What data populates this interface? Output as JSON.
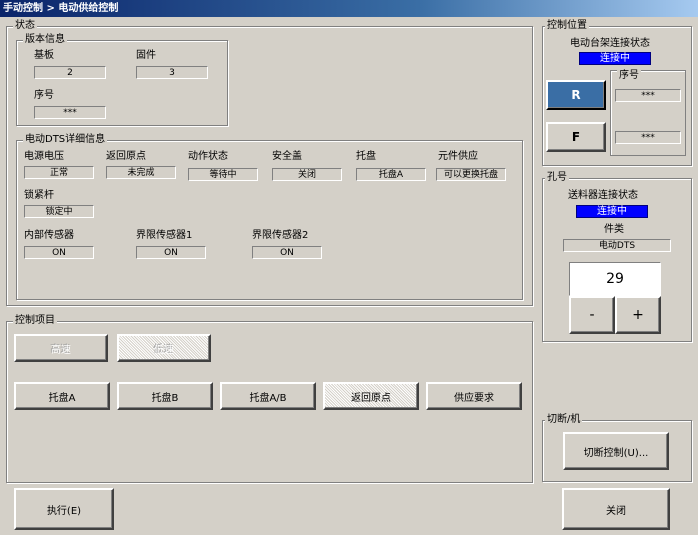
{
  "window": {
    "title": "手动控制 > 电动供给控制"
  },
  "status": {
    "label": "状态",
    "version": {
      "label": "版本信息",
      "board_label": "基板",
      "board_value": "2",
      "firmware_label": "固件",
      "firmware_value": "3",
      "serial_label": "序号",
      "serial_value": "***"
    },
    "dts": {
      "label": "电动DTS详细信息",
      "supply_voltage_label": "电源电压",
      "supply_voltage_value": "正常",
      "return_origin_label": "返回原点",
      "return_origin_value": "未完成",
      "action_status_label": "动作状态",
      "action_status_value": "等待中",
      "safety_cover_label": "安全盖",
      "safety_cover_value": "关闭",
      "tray_label": "托盘",
      "tray_value": "托盘A",
      "component_supply_label": "元件供应",
      "component_supply_value": "可以更换托盘",
      "lock_lever_label": "锁紧杆",
      "lock_lever_value": "锁定中",
      "internal_sensor_label": "内部传感器",
      "internal_sensor_value": "ON",
      "limit_sensor1_label": "界限传感器1",
      "limit_sensor1_value": "ON",
      "limit_sensor2_label": "界限传感器2",
      "limit_sensor2_value": "ON"
    }
  },
  "control_position": {
    "label": "控制位置",
    "connection_label": "电动台架连接状态",
    "connection_value": "连接中",
    "serial_label": "序号",
    "r_button": "R",
    "r_serial": "***",
    "f_button": "F",
    "f_serial": "***"
  },
  "hole": {
    "label": "孔号",
    "feeder_connection_label": "送料器连接状态",
    "feeder_connection_value": "连接中",
    "type_label": "件类",
    "type_value": "电动DTS",
    "number_value": "29",
    "minus_label": "-",
    "plus_label": "+"
  },
  "control_items": {
    "label": "控制项目",
    "high_speed": "高速",
    "low_speed": "低速",
    "tray_a": "托盘A",
    "tray_b": "托盘B",
    "tray_ab": "托盘A/B",
    "return_origin": "返回原点",
    "supply_request": "供应要求"
  },
  "switch": {
    "label": "切断/机",
    "button_label": "切断控制(U)..."
  },
  "footer": {
    "execute_label": "执行(E)",
    "close_label": "关闭"
  }
}
